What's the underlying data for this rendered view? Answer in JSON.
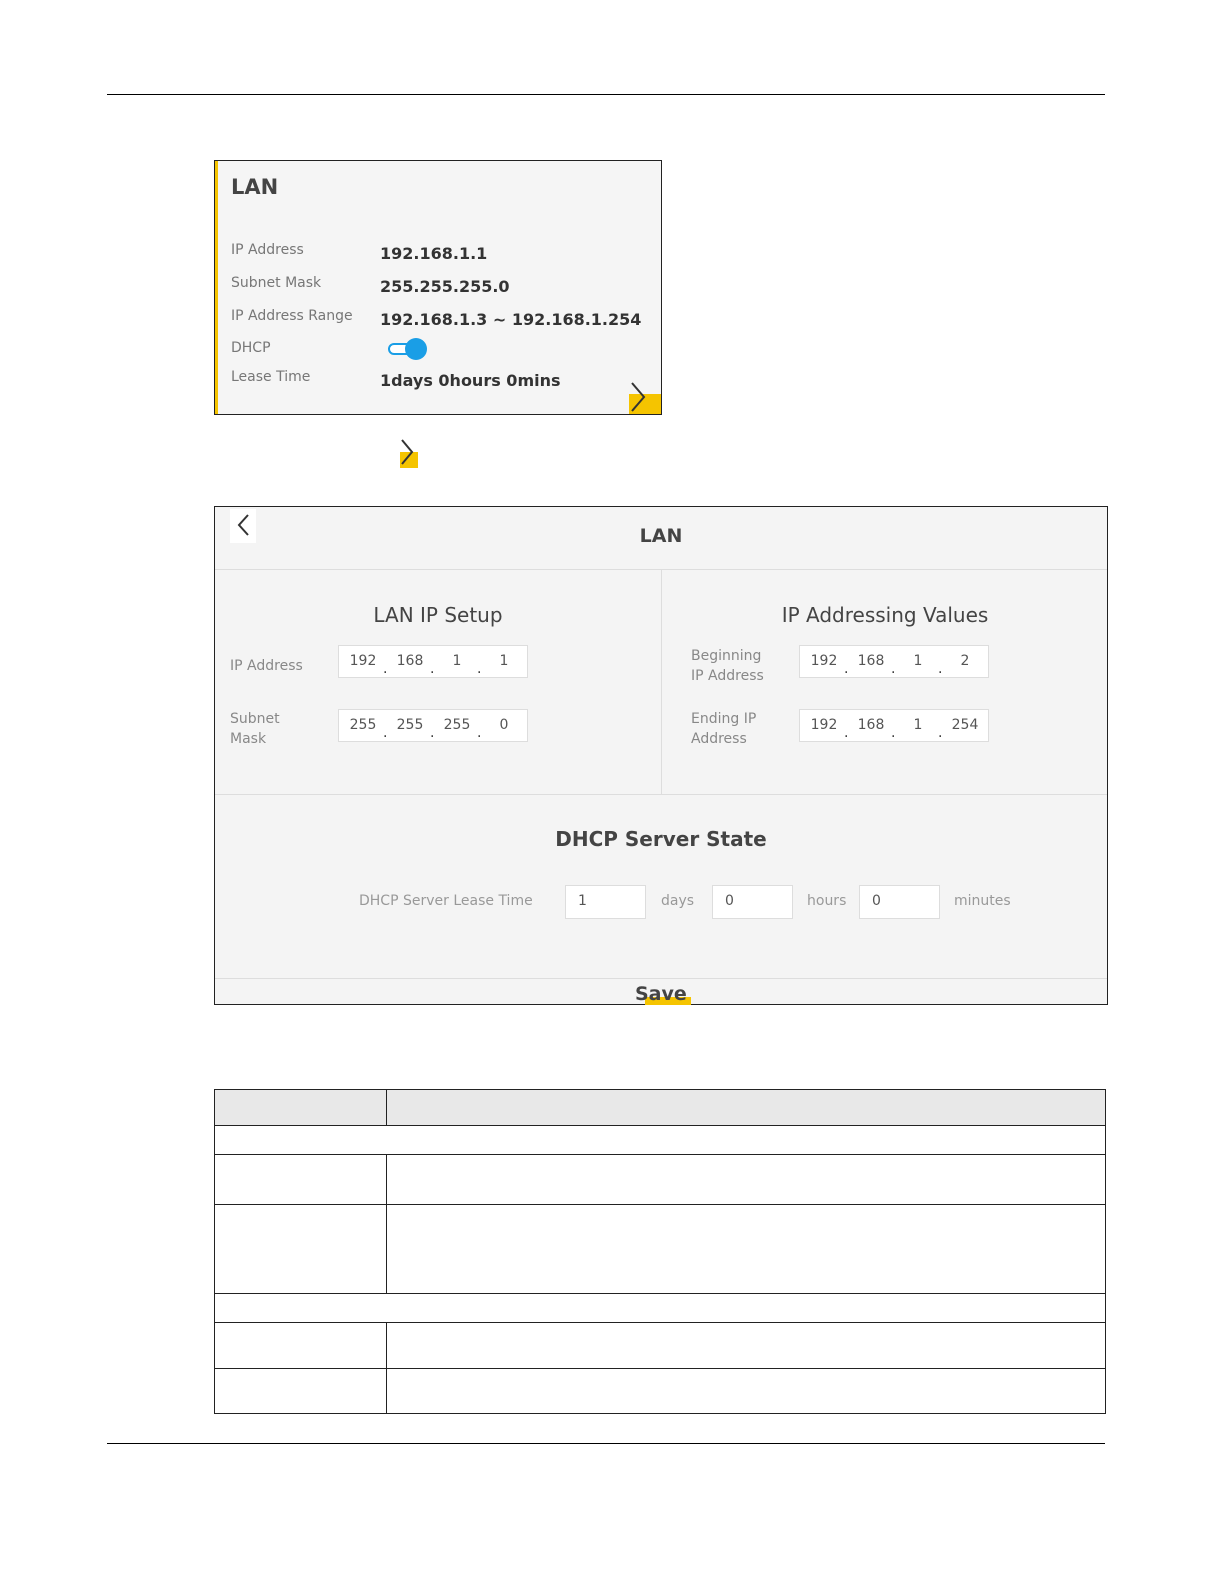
{
  "card": {
    "title": "LAN",
    "rows": [
      {
        "label": "IP Address",
        "value": "192.168.1.1"
      },
      {
        "label": "Subnet Mask",
        "value": "255.255.255.0"
      },
      {
        "label": "IP Address Range",
        "value": "192.168.1.3 ~ 192.168.1.254"
      },
      {
        "label": "DHCP",
        "value": ""
      },
      {
        "label": "Lease Time",
        "value": "1days 0hours 0mins"
      }
    ],
    "dhcp_enabled": true,
    "accent_color": "#f5c400",
    "toggle_color": "#1a9ee6"
  },
  "panel": {
    "title": "LAN",
    "lan_ip_setup": {
      "title": "LAN IP Setup",
      "ip_address": {
        "label": "IP Address",
        "octets": [
          "192",
          "168",
          "1",
          "1"
        ]
      },
      "subnet_mask": {
        "label_line1": "Subnet",
        "label_line2": "Mask",
        "octets": [
          "255",
          "255",
          "255",
          "0"
        ]
      }
    },
    "ip_addressing_values": {
      "title": "IP Addressing Values",
      "beginning": {
        "label_line1": "Beginning",
        "label_line2": "IP Address",
        "octets": [
          "192",
          "168",
          "1",
          "2"
        ]
      },
      "ending": {
        "label_line1": "Ending IP",
        "label_line2": "Address",
        "octets": [
          "192",
          "168",
          "1",
          "254"
        ]
      }
    },
    "dhcp_server": {
      "title": "DHCP Server State",
      "lease_label": "DHCP Server Lease Time",
      "days_value": "1",
      "days_unit": "days",
      "hours_value": "0",
      "hours_unit": "hours",
      "minutes_value": "0",
      "minutes_unit": "minutes"
    },
    "save_label": "Save"
  },
  "icons": [
    "chevron-right-icon",
    "chevron-left-icon"
  ]
}
